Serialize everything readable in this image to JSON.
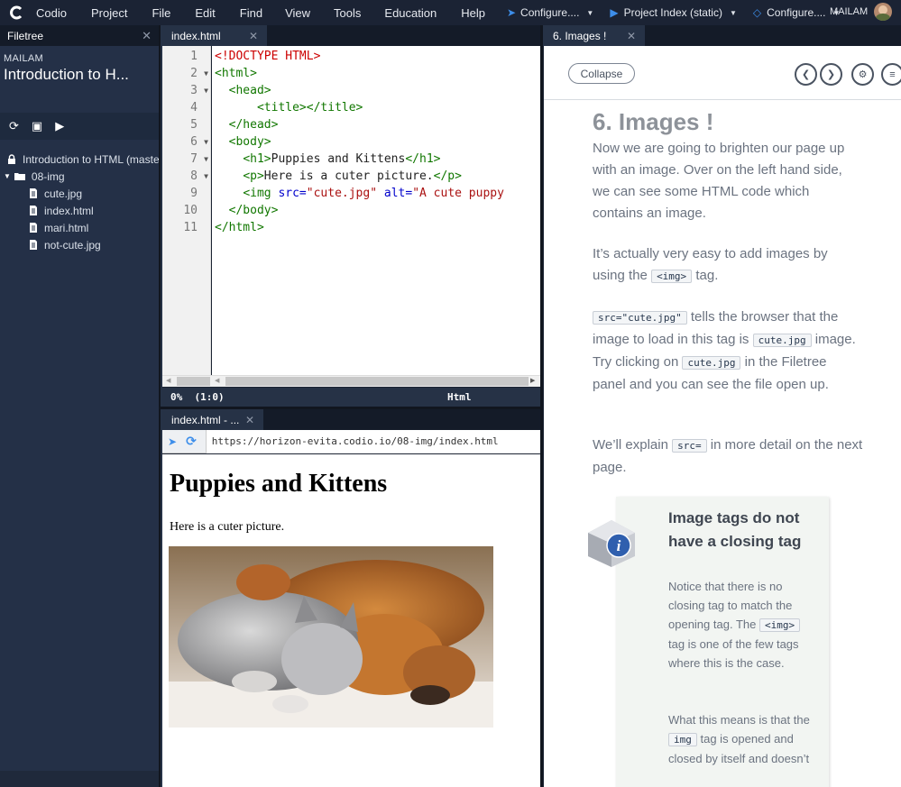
{
  "menubar": {
    "items": [
      "Codio",
      "Project",
      "File",
      "Edit",
      "Find",
      "View",
      "Tools",
      "Education",
      "Help"
    ],
    "configure1": "Configure....",
    "project_index": "Project Index (static)",
    "configure2": "Configure....",
    "user": "MAILAM"
  },
  "sidebar": {
    "tab": "Filetree",
    "owner": "MAILAM",
    "project_title": "Introduction to H...",
    "tree": {
      "root": "Introduction to HTML (master)",
      "folder": "08-img",
      "files": [
        "cute.jpg",
        "index.html",
        "mari.html",
        "not-cute.jpg"
      ]
    }
  },
  "editor": {
    "tab": "index.html",
    "line_numbers": [
      "1",
      "2",
      "3",
      "4",
      "5",
      "6",
      "7",
      "8",
      "9",
      "10",
      "11"
    ],
    "status_left": "0%  (1:0)",
    "status_mode": "Html",
    "code": {
      "l1": "<!DOCTYPE HTML>",
      "l2": "<html>",
      "l3": "<head>",
      "l4a": "<title>",
      "l4b": "</title>",
      "l5": "</head>",
      "l6": "<body>",
      "l7a": "<h1>",
      "l7b": "Puppies and Kittens",
      "l7c": "</h1>",
      "l8a": "<p>",
      "l8b": "Here is a cuter picture.",
      "l8c": "</p>",
      "l9a": "<img",
      "l9b": " src=",
      "l9c": "\"cute.jpg\"",
      "l9d": " alt=",
      "l9e": "\"A cute puppy",
      "l10": "</body>",
      "l11": "</html>"
    }
  },
  "preview": {
    "tab": "index.html - ...",
    "url": "https://horizon-evita.codio.io/08-img/index.html",
    "h1": "Puppies and Kittens",
    "p": "Here is a cuter picture."
  },
  "guide": {
    "tab": "6. Images !",
    "collapse": "Collapse",
    "title": "6. Images !",
    "p1": "Now we are going to brighten our page up with an image. Over on the left hand side, we can see some HTML code which contains an image.",
    "p2a": "It’s actually very easy to add images by using the",
    "p2code": "<img>",
    "p2b": "tag.",
    "p3code1": "src=\"cute.jpg\"",
    "p3a": "tells the browser that the image to load in this tag is",
    "p3code2": "cute.jpg",
    "p3b": "image. Try clicking on",
    "p3code3": "cute.jpg",
    "p3c": "in the Filetree panel and you can see the file open up.",
    "p4a": "We’ll explain",
    "p4code": "src=",
    "p4b": "in more detail on the next page.",
    "note_title": "Image tags do not have a closing tag",
    "note1a": "Notice that there is no closing tag to match the opening tag. The",
    "note1code": "<img>",
    "note1b": "tag is one of the few tags where this is the case.",
    "note2a": "What this means is that the",
    "note2code": "img",
    "note2b": "tag is opened and closed by itself and doesn’t"
  }
}
